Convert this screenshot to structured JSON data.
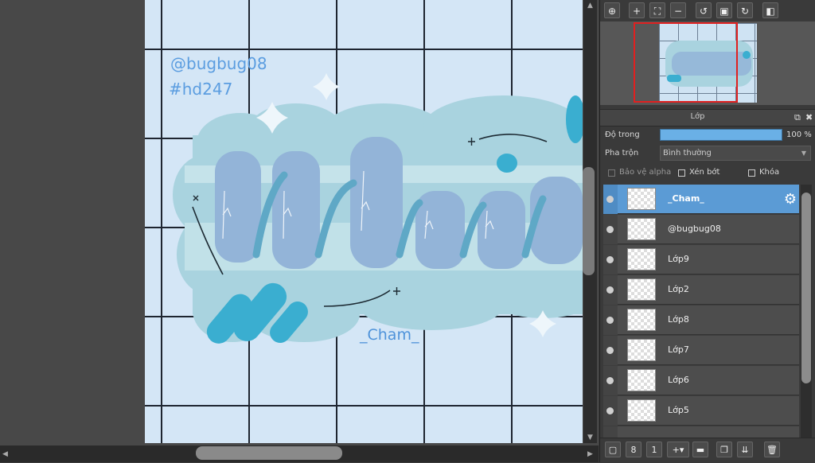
{
  "canvas": {
    "watermark_user": "@bugbug08",
    "watermark_tag": "#hd247",
    "signature": "_Cham_",
    "colors": {
      "canvas_bg": "#d4e6f6",
      "cloud": "#a9d3df",
      "letters": "#93b4d8",
      "accent": "#3aaed0",
      "watermark": "#5b9de0"
    }
  },
  "toolbar": {
    "icons": [
      "zoom-fit-icon",
      "zoom-in-icon",
      "fit-window-icon",
      "zoom-out-icon",
      "rotate-left-icon",
      "reset-view-icon",
      "rotate-right-icon",
      "flip-horizontal-icon"
    ]
  },
  "layer_panel": {
    "title": "Lớp",
    "opacity_label": "Độ trong",
    "opacity_value": "100 %",
    "opacity_percent": 100,
    "blend_label": "Pha trộn",
    "blend_value": "Bình thường",
    "protect_alpha_label": "Bảo vệ alpha",
    "clipping_label": "Xén bớt",
    "lock_label": "Khóa",
    "layers": [
      {
        "name": "_Cham_",
        "selected": true
      },
      {
        "name": "@bugbug08",
        "selected": false
      },
      {
        "name": "Lớp9",
        "selected": false
      },
      {
        "name": "Lớp2",
        "selected": false
      },
      {
        "name": "Lớp8",
        "selected": false
      },
      {
        "name": "Lớp7",
        "selected": false
      },
      {
        "name": "Lớp6",
        "selected": false
      },
      {
        "name": "Lớp5",
        "selected": false
      }
    ]
  },
  "bottom_toolbar": {
    "icons": [
      "new-layer-icon",
      "new-8bit-layer-icon",
      "new-1bit-layer-icon",
      "add-layer-menu-icon",
      "new-folder-icon",
      "duplicate-layer-icon",
      "merge-layer-icon",
      "delete-layer-icon"
    ]
  }
}
